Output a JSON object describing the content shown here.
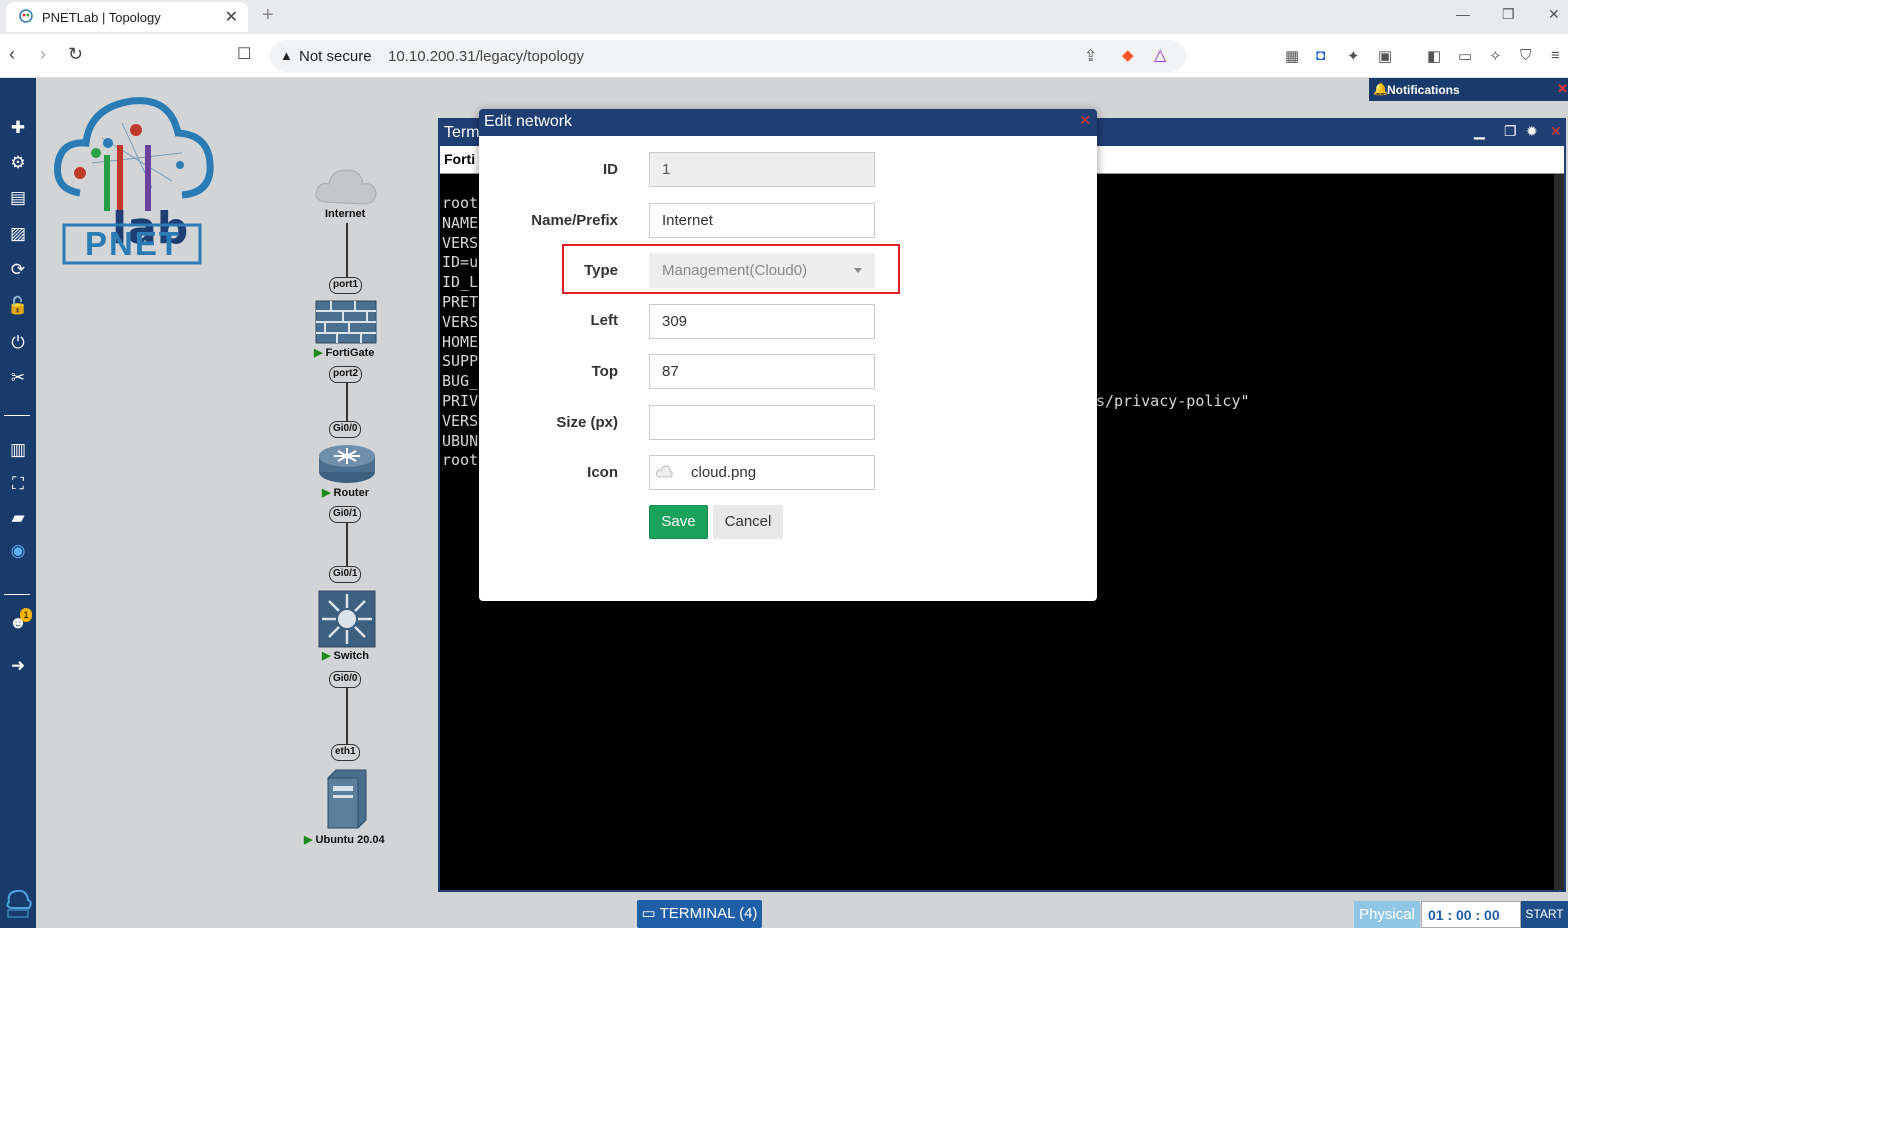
{
  "browser": {
    "tab_title": "PNETLab | Topology",
    "tab_close": "✕",
    "new_tab": "+",
    "security_label": "Not secure",
    "url": "10.10.200.31/legacy/topology"
  },
  "logo": {
    "text": "PNET",
    "lab_text": "lab"
  },
  "topology": {
    "nodes": {
      "internet": "Internet",
      "fortigate": "FortiGate",
      "router": "Router",
      "switch": "Switch",
      "ubuntu": "Ubuntu 20.04"
    },
    "ports": {
      "fg_port1": "port1",
      "fg_port2": "port2",
      "r_gi00": "Gi0/0",
      "r_gi01": "Gi0/1",
      "sw_gi01": "Gi0/1",
      "sw_gi00": "Gi0/0",
      "ub_eth1": "eth1"
    }
  },
  "terminal": {
    "title": "Term",
    "tab": "Forti",
    "lines": "root\nNAME\nVERS\nID=u\nID_L\nPRET\nVERS\nHOME\nSUPP\nBUG_\nPRIV\nVERS\nUBUN\nroot",
    "right_text": "s/privacy-policy\""
  },
  "modal": {
    "title": "Edit network",
    "fields": {
      "id_label": "ID",
      "id_value": "1",
      "name_label": "Name/Prefix",
      "name_value": "Internet",
      "type_label": "Type",
      "type_value": "Management(Cloud0)",
      "left_label": "Left",
      "left_value": "309",
      "top_label": "Top",
      "top_value": "87",
      "size_label": "Size (px)",
      "size_value": "",
      "icon_label": "Icon",
      "icon_value": "cloud.png"
    },
    "save": "Save",
    "cancel": "Cancel"
  },
  "notifications": {
    "title": "Notifications"
  },
  "bottom": {
    "terminal_btn": "TERMINAL (4)",
    "physical": "Physical",
    "timer": "01  : 00  : 00",
    "start": "START"
  },
  "sidebar_badge": "1"
}
